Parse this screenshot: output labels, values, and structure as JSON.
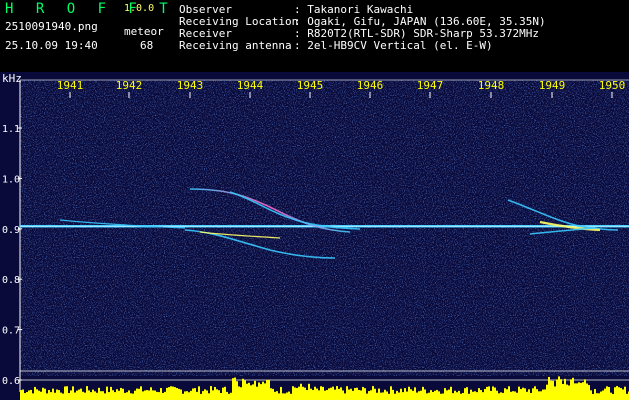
{
  "app": {
    "brand": "H R O F F T",
    "version": "1.0.0",
    "filename": "2510091940.png",
    "datetime": "25.10.09 19:40",
    "meteor_label": "meteor",
    "meteor_count": "68"
  },
  "station": [
    {
      "label": "Observer",
      "value": ": Takanori Kawachi"
    },
    {
      "label": "Receiving Location",
      "value": ": Ogaki, Gifu, JAPAN (136.60E, 35.35N)"
    },
    {
      "label": "Receiver",
      "value": ": R820T2(RTL-SDR) SDR-Sharp 53.372MHz"
    },
    {
      "label": "Receiving antenna",
      "value": ": 2el-HB9CV Vertical (el. E-W)"
    }
  ],
  "spectrogram": {
    "y_unit": "kHz",
    "y_ticks": [
      "1.1",
      "1.0",
      "0.9",
      "0.8",
      "0.7",
      "0.6"
    ],
    "x_ticks": [
      "1941",
      "1942",
      "1943",
      "1944",
      "1945",
      "1946",
      "1947",
      "1948",
      "1949",
      "1950"
    ],
    "colors": {
      "background": "#0a0a3a",
      "carrier": "#ffffff",
      "trace": "#39c8ff",
      "trace_hot": "#ffff66",
      "activity": "#ffff00",
      "axis": "#ffffff"
    }
  }
}
